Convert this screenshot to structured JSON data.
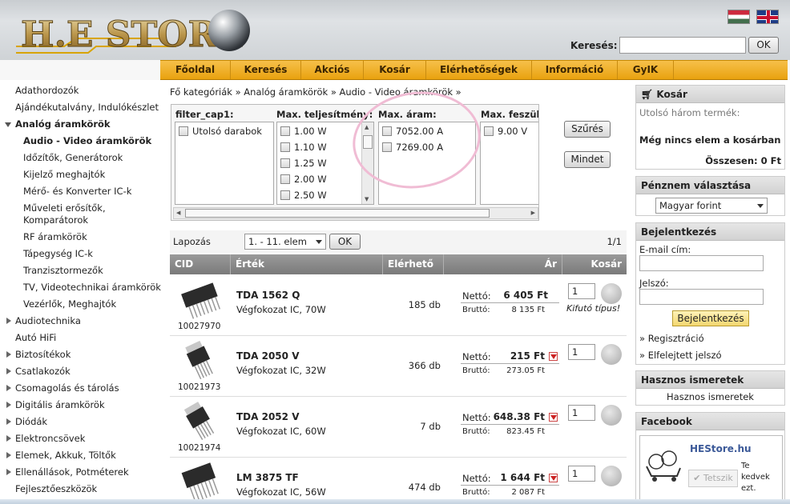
{
  "header": {
    "search_label": "Keresés:",
    "search_value": "",
    "search_button": "OK",
    "flags": [
      "hungarian-flag-icon",
      "uk-flag-icon"
    ]
  },
  "nav": [
    "Főoldal",
    "Keresés",
    "Akciós",
    "Kosár",
    "Elérhetőségek",
    "Információ",
    "GyIK"
  ],
  "sidebar": {
    "items": [
      "Adathordozók",
      "Ajándékutalvány, Indulókészlet",
      "Analóg áramkörök",
      "Audio - Video áramkörök",
      "Időzítők, Generátorok",
      "Kijelző meghajtók",
      "Mérő- és Konverter IC-k",
      "Műveleti erősítők,",
      "Komparátorok",
      "RF áramkörök",
      "Tápegység IC-k",
      "Tranzisztormezők",
      "TV, Videotechnikai áramkörök",
      "Vezérlők, Meghajtók",
      "Audiotechnika",
      "Autó HiFi",
      "Biztosítékok",
      "Csatlakozók",
      "Csomagolás és tárolás",
      "Digitális áramkörök",
      "Diódák",
      "Elektroncsövek",
      "Elemek, Akkuk, Töltők",
      "Ellenállások, Potméterek",
      "Fejlesztőeszközök"
    ]
  },
  "breadcrumb": "Fő kategóriák » Analóg áramkörök » Audio - Video áramkörök »",
  "filters": {
    "col1": {
      "title": "filter_cap1:",
      "options": [
        "Utolsó darabok"
      ]
    },
    "col2": {
      "title": "Max. teljesítmény:",
      "options": [
        "1.00 W",
        "1.10 W",
        "1.25 W",
        "2.00 W",
        "2.50 W"
      ]
    },
    "col3": {
      "title": "Max. áram:",
      "options": [
        "7052.00 A",
        "7269.00 A"
      ]
    },
    "col4": {
      "title": "Max. feszült",
      "options": [
        "9.00 V"
      ]
    },
    "filter_button": "Szűrés",
    "all_button": "Mindet"
  },
  "pager": {
    "label": "Lapozás",
    "select_value": "1. - 11. elem",
    "ok": "OK",
    "pages": "1/1"
  },
  "table": {
    "headers": [
      "CID",
      "Érték",
      "Elérhető",
      "Ár",
      "Kosár"
    ],
    "rows": [
      {
        "cid": "10027970",
        "name": "TDA 1562 Q",
        "desc": "Végfokozat IC, 70W",
        "avail": "185 db",
        "net_label": "Nettó:",
        "net": "6 405 Ft",
        "gross_label": "Bruttó:",
        "gross": "8 135 Ft",
        "qty": "1",
        "note": "Kifutó típus!",
        "arrow": false
      },
      {
        "cid": "10021973",
        "name": "TDA 2050 V",
        "desc": "Végfokozat IC, 32W",
        "avail": "366 db",
        "net_label": "Nettó:",
        "net": "215 Ft",
        "gross_label": "Bruttó:",
        "gross": "273.05 Ft",
        "qty": "1",
        "note": "",
        "arrow": true
      },
      {
        "cid": "10021974",
        "name": "TDA 2052 V",
        "desc": "Végfokozat IC, 60W",
        "avail": "7 db",
        "net_label": "Nettó:",
        "net": "648.38 Ft",
        "gross_label": "Bruttó:",
        "gross": "823.45 Ft",
        "qty": "1",
        "note": "",
        "arrow": true
      },
      {
        "cid": "",
        "name": "LM 3875 TF",
        "desc": "Végfokozat IC, 56W",
        "avail": "474 db",
        "net_label": "Nettó:",
        "net": "1 644 Ft",
        "gross_label": "Bruttó:",
        "gross": "2 087 Ft",
        "qty": "1",
        "note": "",
        "arrow": true
      }
    ]
  },
  "cart": {
    "title": "Kosár",
    "recent": "Utolsó három termék:",
    "empty": "Még nincs elem a kosárban",
    "total": "Összesen: 0 Ft"
  },
  "currency": {
    "title": "Pénznem választása",
    "value": "Magyar forint"
  },
  "login": {
    "title": "Bejelentkezés",
    "email_label": "E-mail cím:",
    "password_label": "Jelszó:",
    "button": "Bejelentkezés",
    "register": "» Regisztráció",
    "forgot": "» Elfelejtett jelszó"
  },
  "useful": {
    "title": "Hasznos ismeretek",
    "link": "Hasznos ismeretek"
  },
  "facebook": {
    "title": "Facebook",
    "page_name": "HEStore.hu",
    "like_button": "✔ Tetszik",
    "side_text_1": "Te",
    "side_text_2": "kedvek",
    "side_text_3": "ezt."
  }
}
